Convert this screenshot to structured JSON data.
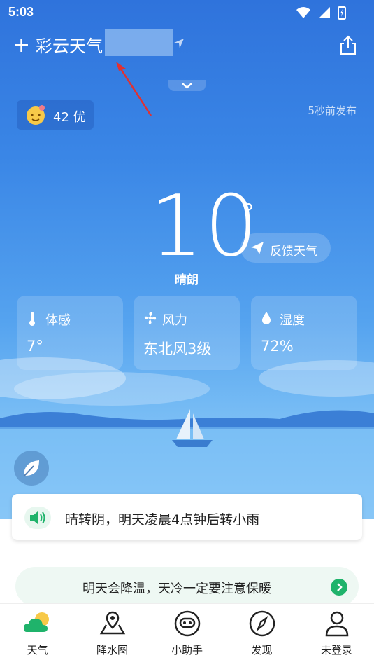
{
  "status": {
    "time": "5:03"
  },
  "header": {
    "title": "彩云天气"
  },
  "aqi": {
    "value": "42 优"
  },
  "publish": {
    "text": "5秒前发布"
  },
  "current": {
    "temperature": "10",
    "degree_symbol": "°",
    "condition": "晴朗"
  },
  "feedback": {
    "label": "反馈天气"
  },
  "cards": [
    {
      "label": "体感",
      "value": "7°",
      "icon": "thermometer-icon"
    },
    {
      "label": "风力",
      "value": "东北风3级",
      "icon": "fan-icon"
    },
    {
      "label": "湿度",
      "value": "72%",
      "icon": "drop-icon"
    }
  ],
  "forecast": {
    "text": "晴转阴，明天凌晨4点钟后转小雨"
  },
  "tip": {
    "text": "明天会降温，天冷一定要注意保暖"
  },
  "nav": [
    {
      "label": "天气",
      "icon": "weather-icon"
    },
    {
      "label": "降水图",
      "icon": "map-pin-icon"
    },
    {
      "label": "小助手",
      "icon": "assistant-icon"
    },
    {
      "label": "发现",
      "icon": "compass-icon"
    },
    {
      "label": "未登录",
      "icon": "user-icon"
    }
  ],
  "colors": {
    "sky_top": "#2f73dc",
    "sky_bottom": "#9fd3fb",
    "accent_green": "#1fb36b",
    "annotation_arrow": "#e03131"
  }
}
